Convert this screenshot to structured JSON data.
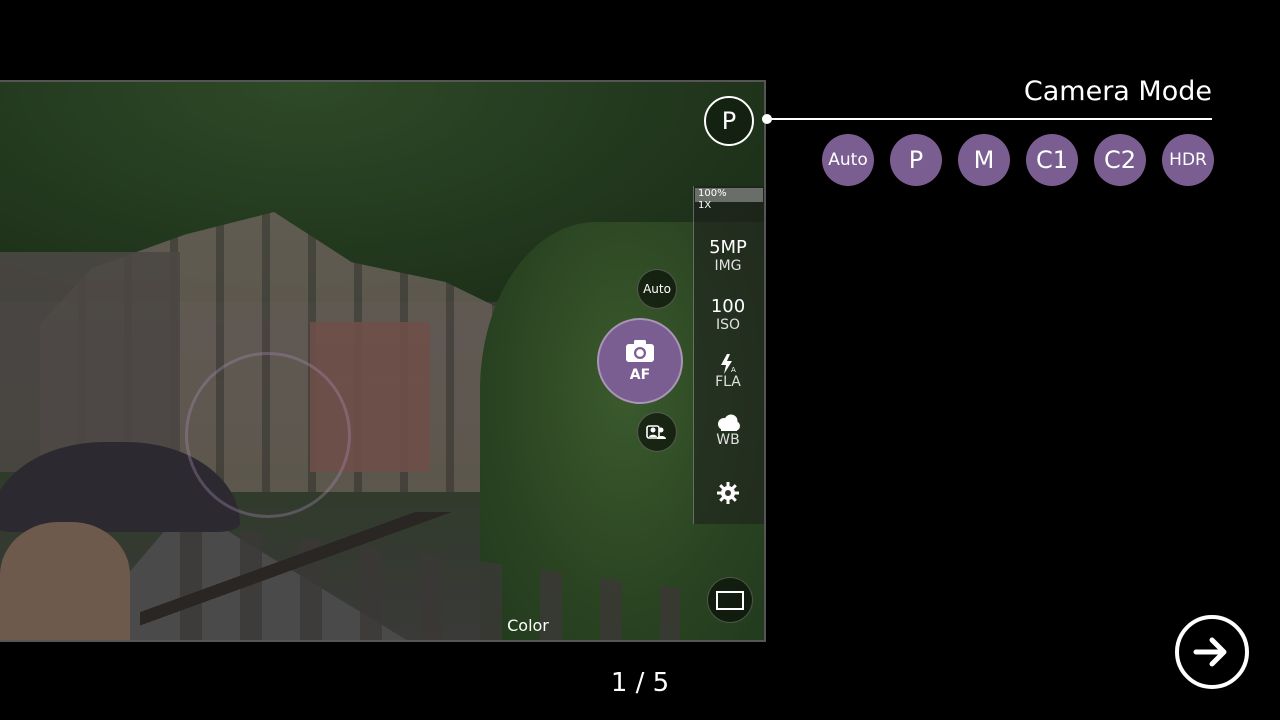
{
  "viewfinder": {
    "mode_button": "P",
    "auto_button": "Auto",
    "shutter_label": "AF",
    "color_label": "Color",
    "zoom": {
      "percent": "100%",
      "factor": "1X",
      "level": 1.0
    },
    "settings": [
      {
        "main": "5MP",
        "sub": "IMG"
      },
      {
        "main": "100",
        "sub": "ISO"
      },
      {
        "icon": "flash-auto-icon",
        "sub": "FLA"
      },
      {
        "icon": "cloud-icon",
        "sub": "WB"
      },
      {
        "icon": "gear-icon"
      }
    ]
  },
  "callout": {
    "title": "Camera Mode",
    "modes": [
      "Auto",
      "P",
      "M",
      "C1",
      "C2",
      "HDR"
    ]
  },
  "pager": {
    "text": "1 / 5"
  },
  "colors": {
    "accent": "#7a5d91",
    "background": "#000000"
  }
}
